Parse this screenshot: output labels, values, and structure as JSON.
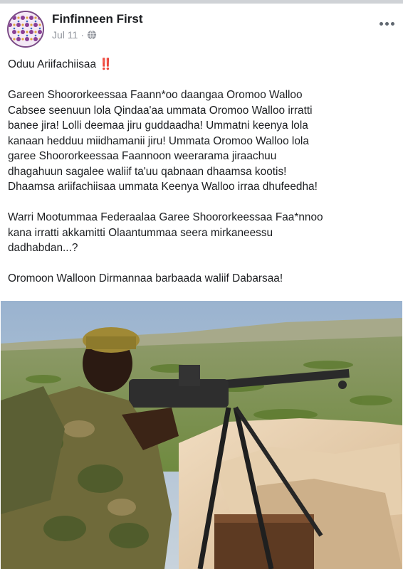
{
  "post": {
    "page_name": "Finfinneen First",
    "date": "Jul 11",
    "privacy_icon": "globe-icon",
    "options_icon": "more-options-icon",
    "title_line": "Oduu Ariifachiisaa",
    "title_emoji": "‼️",
    "paragraphs": [
      "Gareen Shoororkeessaa Faann*oo daangaa Oromoo Walloo\nCabsee seenuun lola Qindaa'aa ummata Oromoo Walloo irratti\nbanee jira! Lolli deemaa jiru guddaadha! Ummatni keenya lola\nkanaan hedduu miidhamanii jiru! Ummata Oromoo Walloo lola\ngaree Shoororkeessaa Faannoon weerarama jiraachuu\ndhagahuun sagalee waliif ta'uu qabnaan dhaamsa kootis!\nDhaamsa ariifachiisaa ummata Keenya Walloo irraa dhufeedha!",
      "Warri Mootummaa Federaalaa Garee Shoororkeessaa Faa*nnoo\nkana irratti akkamitti Olaantummaa seera mirkaneessu\ndadhabdan...?",
      "Oromoon Walloon Dirmannaa barbaada waliif Dabarsaa!"
    ]
  },
  "colors": {
    "text": "#1c1e21",
    "meta": "#90949c",
    "emoji_red": "#e02c2c"
  }
}
